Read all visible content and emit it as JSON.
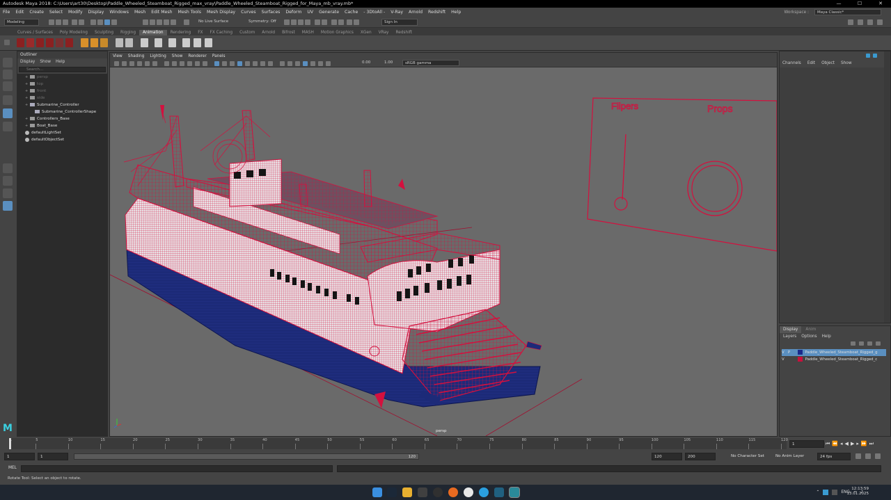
{
  "window": {
    "title": "Autodesk Maya 2018: C:\\Users\\art30\\Desktop\\Paddle_Wheeled_Steamboat_Rigged_max_vray\\Paddle_Wheeled_Steamboat_Rigged_for_Maya_mb_vray.mb*",
    "minimize": "—",
    "maximize": "☐",
    "close": "✕"
  },
  "menubar": {
    "items": [
      "File",
      "Edit",
      "Create",
      "Select",
      "Modify",
      "Display",
      "Windows",
      "Mesh",
      "Edit Mesh",
      "Mesh Tools",
      "Mesh Display",
      "Curves",
      "Surfaces",
      "Deform",
      "UV",
      "Generate",
      "Cache",
      "- 3DtoAll -",
      "V-Ray",
      "Arnold",
      "Redshift",
      "Help"
    ],
    "workspace_label": "Workspace :",
    "workspace_value": "Maya Classic*"
  },
  "statusline": {
    "mode": "Modeling",
    "live_surface": "No Live Surface",
    "symmetry": "Symmetry: Off",
    "sign_in": "Sign In"
  },
  "shelf_tabs": [
    "Curves / Surfaces",
    "Poly Modeling",
    "Sculpting",
    "Rigging",
    "Animation",
    "Rendering",
    "FX",
    "FX Caching",
    "Custom",
    "Arnold",
    "Bifrost",
    "MASH",
    "Motion Graphics",
    "XGen",
    "VRay",
    "Redshift"
  ],
  "shelf_active": "Animation",
  "outliner": {
    "title": "Outliner",
    "menu": [
      "Display",
      "Show",
      "Help"
    ],
    "search_placeholder": "Search...",
    "items": [
      {
        "label": "persp",
        "dim": true,
        "indent": 1,
        "icon": "camera-icon"
      },
      {
        "label": "top",
        "dim": true,
        "indent": 1,
        "icon": "camera-icon"
      },
      {
        "label": "front",
        "dim": true,
        "indent": 1,
        "icon": "camera-icon"
      },
      {
        "label": "side",
        "dim": true,
        "indent": 1,
        "icon": "camera-icon"
      },
      {
        "label": "Submarine_Controller",
        "dim": false,
        "indent": 1,
        "icon": "curve-icon",
        "expanded": true
      },
      {
        "label": "Submarine_ControllerShape",
        "dim": false,
        "indent": 2,
        "icon": "shape-icon"
      },
      {
        "label": "Controllers_Base",
        "dim": false,
        "indent": 1,
        "icon": "transform-icon"
      },
      {
        "label": "Boat_Base",
        "dim": false,
        "indent": 1,
        "icon": "transform-icon"
      },
      {
        "label": "defaultLightSet",
        "dim": false,
        "indent": 0,
        "icon": "set-icon"
      },
      {
        "label": "defaultObjectSet",
        "dim": false,
        "indent": 0,
        "icon": "set-icon"
      }
    ]
  },
  "viewport": {
    "menu": [
      "View",
      "Shading",
      "Lighting",
      "Show",
      "Renderer",
      "Panels"
    ],
    "exposure": "0.00",
    "gamma": "1.00",
    "color_space": "sRGB gamma",
    "camera": "persp",
    "control_labels": {
      "left": "Flipers",
      "right": "Props"
    }
  },
  "channelbox": {
    "menu": [
      "Channels",
      "Edit",
      "Object",
      "Show"
    ]
  },
  "layers": {
    "tabs": [
      "Display",
      "Anim"
    ],
    "active_tab": "Display",
    "menu": [
      "Layers",
      "Options",
      "Help"
    ],
    "rows": [
      {
        "v": "V",
        "p": "P",
        "name": "Paddle_Wheeled_Steamboat_Rigged_g",
        "color": "#1a2a8a",
        "selected": true
      },
      {
        "v": "V",
        "p": "",
        "name": "Paddle_Wheeled_Steamboat_Rigged_c",
        "color": "#c8103c",
        "selected": false
      }
    ]
  },
  "timeslider": {
    "labels": [
      "1",
      "5",
      "10",
      "15",
      "20",
      "25",
      "30",
      "35",
      "40",
      "45",
      "50",
      "55",
      "60",
      "65",
      "70",
      "75",
      "80",
      "85",
      "90",
      "95",
      "100",
      "105",
      "110",
      "115",
      "120"
    ],
    "current_frame": "1"
  },
  "range": {
    "start": "1",
    "inner_start": "1",
    "slider_end": "120",
    "end": "120",
    "outer_end": "200",
    "character_set": "No Character Set",
    "anim_layer": "No Anim Layer",
    "fps": "24 fps"
  },
  "cmdline": {
    "label": "MEL"
  },
  "helpline": {
    "text": "Rotate Tool: Select an object to rotate."
  },
  "taskbar": {
    "language": "ENG",
    "time": "12:13:59",
    "date": "13.01.2025"
  },
  "colors": {
    "wire": "#d4103e",
    "viewport_bg": "#6a6a6a",
    "hull_blue": "#1c2a78",
    "accent_blue": "#5a8fc0"
  }
}
